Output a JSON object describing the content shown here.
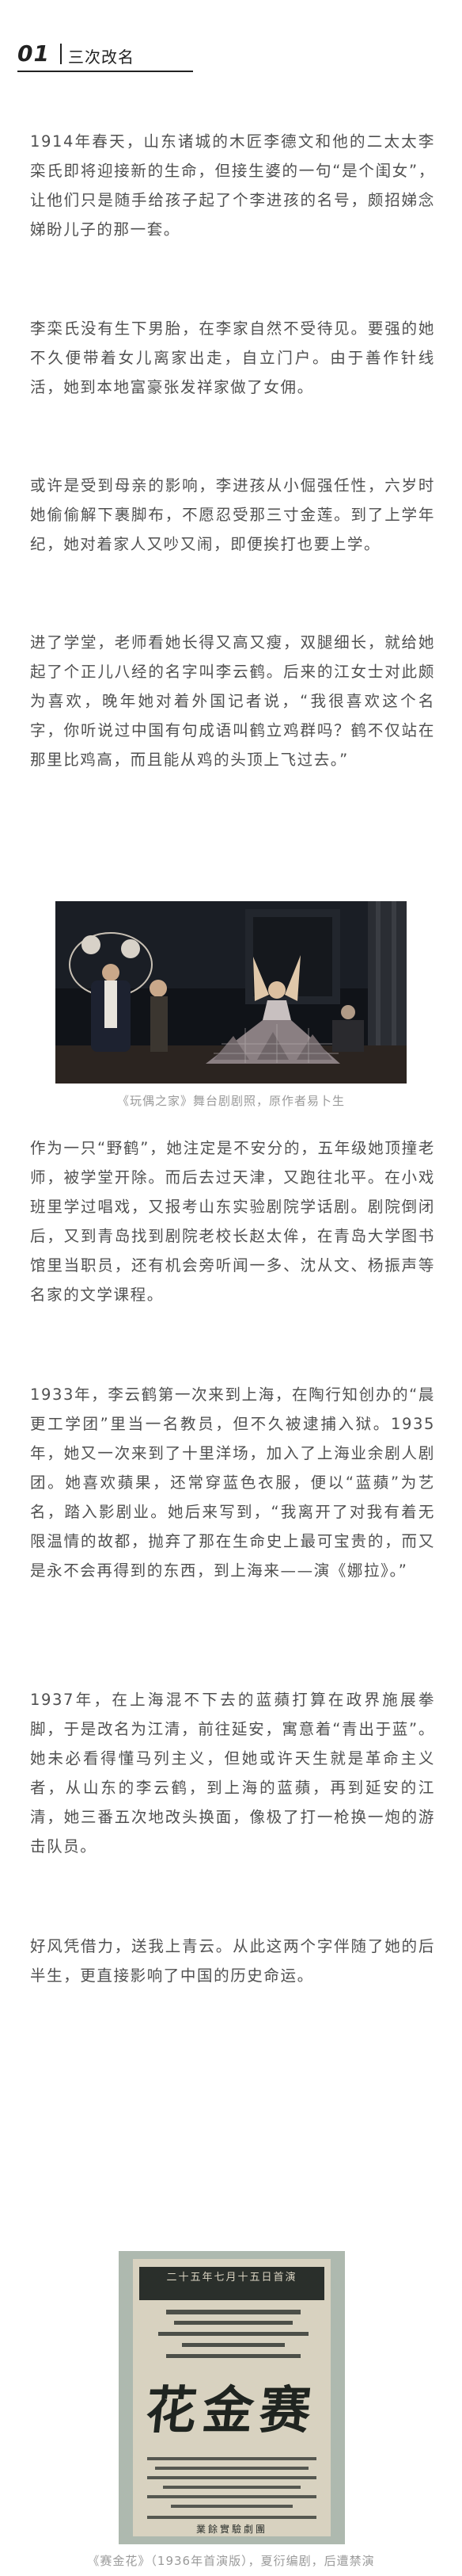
{
  "header": {
    "number": "01",
    "title": "三次改名"
  },
  "paragraphs": [
    "1914年春天，山东诸城的木匠李德文和他的二太太李栾氏即将迎接新的生命，但接生婆的一句“是个闺女”，让他们只是随手给孩子起了个李进孩的名号，颇招娣念娣盼儿子的那一套。",
    "李栾氏没有生下男胎，在李家自然不受待见。要强的她不久便带着女儿离家出走，自立门户。由于善作针线活，她到本地富豪张发祥家做了女佣。",
    "或许是受到母亲的影响，李进孩从小倔强任性，六岁时她偷偷解下裹脚布，不愿忍受那三寸金莲。到了上学年纪，她对着家人又吵又闹，即便挨打也要上学。",
    "进了学堂，老师看她长得又高又瘦，双腿细长，就给她起了个正儿八经的名字叫李云鹤。后来的江女士对此颇为喜欢，晚年她对着外国记者说，“我很喜欢这个名字，你听说过中国有句成语叫鹤立鸡群吗？鹤不仅站在那里比鸡高，而且能从鸡的头顶上飞过去。”",
    "作为一只“野鹤”，她注定是不安分的，五年级她顶撞老师，被学堂开除。而后去过天津，又跑往北平。在小戏班里学过唱戏，又报考山东实验剧院学话剧。剧院倒闭后，又到青岛找到剧院老校长赵太侔，在青岛大学图书馆里当职员，还有机会旁听闻一多、沈从文、杨振声等名家的文学课程。",
    "1933年，李云鹤第一次来到上海，在陶行知创办的“晨更工学团”里当一名教员，但不久被逮捕入狱。1935年，她又一次来到了十里洋场，加入了上海业余剧人剧团。她喜欢蘋果，还常穿蓝色衣服，便以“蓝蘋”为艺名，踏入影剧业。她后来写到，“我离开了对我有着无限温情的故都，抛弃了那在生命史上最可宝贵的，而又是永不会再得到的东西，到上海来——演《娜拉》。”",
    "1937年，在上海混不下去的蓝蘋打算在政界施展拳脚，于是改名为江清，前往延安，寓意着“青出于蓝”。她未必看得懂马列主义，但她或许天生就是革命主义者，从山东的李云鹤，到上海的蓝蘋，再到延安的江清，她三番五次地改头换面，像极了打一枪换一炮的游击队员。",
    "好风凭借力，送我上青云。从此这两个字伴随了她的后半生，更直接影响了中国的历史命运。"
  ],
  "photo_caption": "《玩偶之家》舞台剧剧照，原作者易卜生",
  "poster": {
    "title": "花金赛",
    "top_text": "二十五年七月十五日首演",
    "bottom_text": "業餘實驗劇團"
  },
  "poster_caption": "《赛金花》（1936年首演版），夏衍编剧，后遭禁演"
}
